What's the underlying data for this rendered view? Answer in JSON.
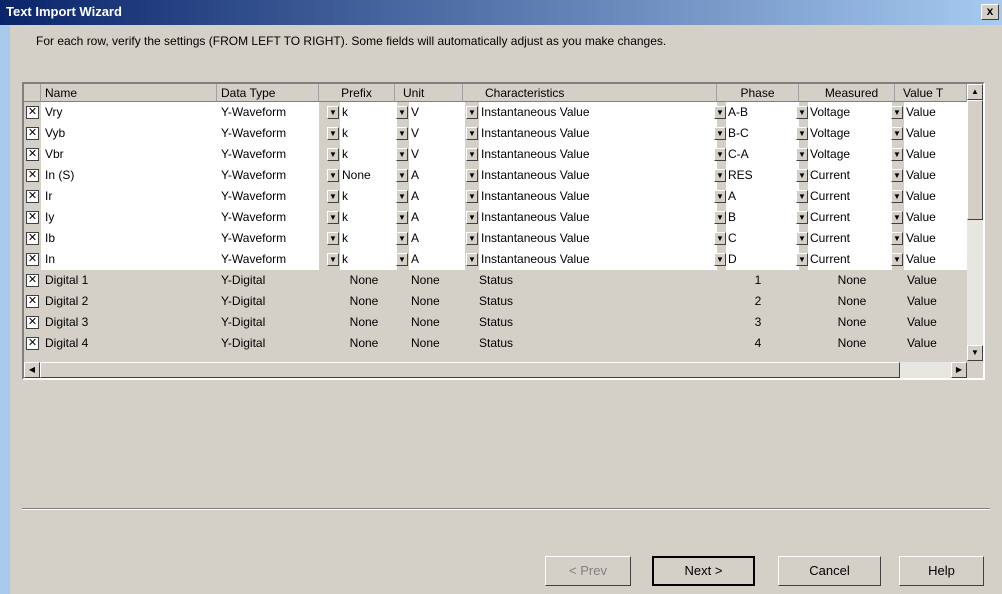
{
  "window": {
    "title": "Text Import Wizard",
    "close_glyph": "x"
  },
  "instruction": "For each row, verify the settings (FROM LEFT TO RIGHT). Some fields will automatically adjust as you make changes.",
  "columns": [
    "Name",
    "Data Type",
    "Prefix",
    "Unit",
    "Characteristics",
    "Phase",
    "Measured",
    "Value T"
  ],
  "rows": [
    {
      "checked": true,
      "name": "Vry",
      "data_type": "Y-Waveform",
      "prefix": "k",
      "unit": "V",
      "characteristics": "Instantaneous Value",
      "phase": "A-B",
      "measured": "Voltage",
      "value": "Value",
      "editable": true
    },
    {
      "checked": true,
      "name": "Vyb",
      "data_type": "Y-Waveform",
      "prefix": "k",
      "unit": "V",
      "characteristics": "Instantaneous Value",
      "phase": "B-C",
      "measured": "Voltage",
      "value": "Value",
      "editable": true
    },
    {
      "checked": true,
      "name": "Vbr",
      "data_type": "Y-Waveform",
      "prefix": "k",
      "unit": "V",
      "characteristics": "Instantaneous Value",
      "phase": "C-A",
      "measured": "Voltage",
      "value": "Value",
      "editable": true
    },
    {
      "checked": true,
      "name": "In (S)",
      "data_type": "Y-Waveform",
      "prefix": "None",
      "unit": "A",
      "characteristics": "Instantaneous Value",
      "phase": "RES",
      "measured": "Current",
      "value": "Value",
      "editable": true
    },
    {
      "checked": true,
      "name": "Ir",
      "data_type": "Y-Waveform",
      "prefix": "k",
      "unit": "A",
      "characteristics": "Instantaneous Value",
      "phase": "A",
      "measured": "Current",
      "value": "Value",
      "editable": true
    },
    {
      "checked": true,
      "name": "Iy",
      "data_type": "Y-Waveform",
      "prefix": "k",
      "unit": "A",
      "characteristics": "Instantaneous Value",
      "phase": "B",
      "measured": "Current",
      "value": "Value",
      "editable": true
    },
    {
      "checked": true,
      "name": "Ib",
      "data_type": "Y-Waveform",
      "prefix": "k",
      "unit": "A",
      "characteristics": "Instantaneous Value",
      "phase": "C",
      "measured": "Current",
      "value": "Value",
      "editable": true
    },
    {
      "checked": true,
      "name": "In",
      "data_type": "Y-Waveform",
      "prefix": "k",
      "unit": "A",
      "characteristics": "Instantaneous Value",
      "phase": "D",
      "measured": "Current",
      "value": "Value",
      "editable": true
    },
    {
      "checked": true,
      "name": "Digital 1",
      "data_type": "Y-Digital",
      "prefix": "None",
      "unit": "None",
      "characteristics": "Status",
      "phase": "1",
      "measured": "None",
      "value": "Value",
      "editable": false
    },
    {
      "checked": true,
      "name": "Digital 2",
      "data_type": "Y-Digital",
      "prefix": "None",
      "unit": "None",
      "characteristics": "Status",
      "phase": "2",
      "measured": "None",
      "value": "Value",
      "editable": false
    },
    {
      "checked": true,
      "name": "Digital 3",
      "data_type": "Y-Digital",
      "prefix": "None",
      "unit": "None",
      "characteristics": "Status",
      "phase": "3",
      "measured": "None",
      "value": "Value",
      "editable": false
    },
    {
      "checked": true,
      "name": "Digital 4",
      "data_type": "Y-Digital",
      "prefix": "None",
      "unit": "None",
      "characteristics": "Status",
      "phase": "4",
      "measured": "None",
      "value": "Value",
      "editable": false
    }
  ],
  "glyphs": {
    "check": "✕",
    "dropdown": "▼",
    "scroll_up": "▲",
    "scroll_down": "▼",
    "scroll_left": "◀",
    "scroll_right": "▶"
  },
  "buttons": {
    "prev": "< Prev",
    "next": "Next >",
    "cancel": "Cancel",
    "help": "Help"
  }
}
